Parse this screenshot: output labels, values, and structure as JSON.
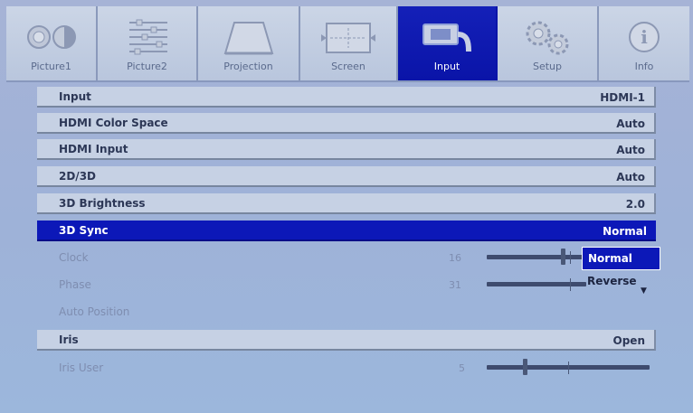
{
  "tabs": [
    {
      "label": "Picture1",
      "icon": "picture1-icon",
      "active": false
    },
    {
      "label": "Picture2",
      "icon": "picture2-icon",
      "active": false
    },
    {
      "label": "Projection",
      "icon": "projection-icon",
      "active": false
    },
    {
      "label": "Screen",
      "icon": "screen-icon",
      "active": false
    },
    {
      "label": "Input",
      "icon": "input-icon",
      "active": true
    },
    {
      "label": "Setup",
      "icon": "setup-icon",
      "active": false
    },
    {
      "label": "Info",
      "icon": "info-icon",
      "active": false
    }
  ],
  "menu": {
    "input": {
      "label": "Input",
      "value": "HDMI-1"
    },
    "hdmi_color_space": {
      "label": "HDMI Color Space",
      "value": "Auto"
    },
    "hdmi_input": {
      "label": "HDMI Input",
      "value": "Auto"
    },
    "mode_2d3d": {
      "label": "2D/3D",
      "value": "Auto"
    },
    "brightness_3d": {
      "label": "3D Brightness",
      "value": "2.0"
    },
    "sync_3d": {
      "label": "3D Sync",
      "value": "Normal"
    },
    "clock": {
      "label": "Clock",
      "value": "16"
    },
    "phase": {
      "label": "Phase",
      "value": "31"
    },
    "auto_position": {
      "label": "Auto Position"
    },
    "iris": {
      "label": "Iris",
      "value": "Open"
    },
    "iris_user": {
      "label": "Iris User",
      "value": "5"
    }
  },
  "dropdown": {
    "options": [
      "Normal",
      "Reverse"
    ],
    "selected": "Normal"
  },
  "colors": {
    "background": "#9eb2d8",
    "selected": "#0c18b8",
    "row": "#c6d1e4"
  }
}
